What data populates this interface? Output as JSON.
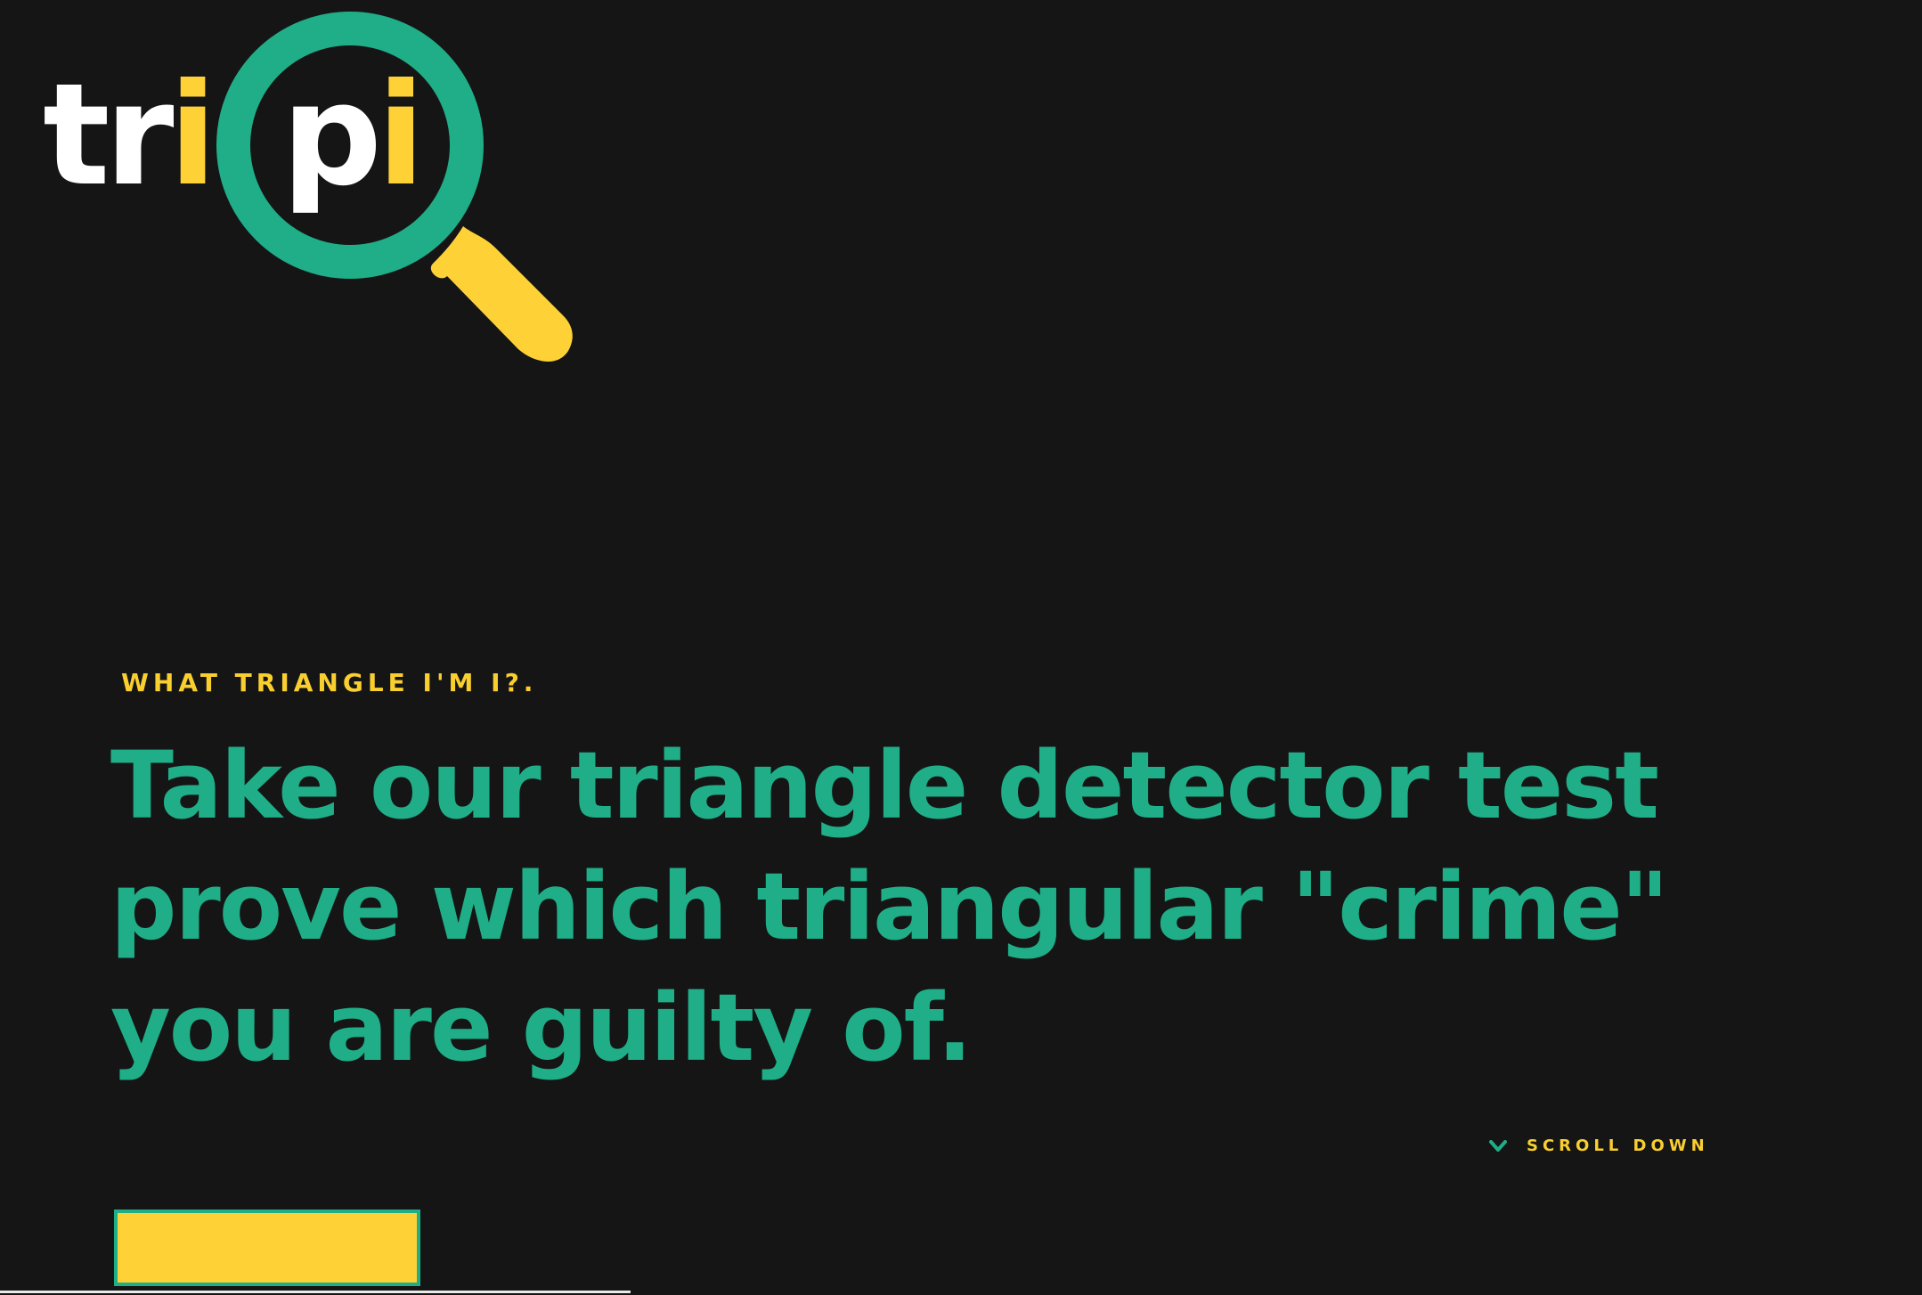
{
  "colors": {
    "background": "#151515",
    "yellow": "#f9cf2f",
    "green": "#1fae87",
    "white": "#ffffff"
  },
  "logo": {
    "left_part": "tr",
    "left_accent": "i",
    "right_part": "p",
    "right_accent": "i",
    "icon": "magnifying-glass-icon"
  },
  "hero": {
    "eyebrow": "WHAT TRIANGLE I'M I?.",
    "headline_lines": [
      "Take our triangle detector test",
      "prove which triangular \"crime\"",
      "you are guilty of."
    ]
  },
  "scroll": {
    "label": "SCROLL DOWN",
    "icon": "chevron-down-icon"
  },
  "cta": {
    "label": ""
  }
}
